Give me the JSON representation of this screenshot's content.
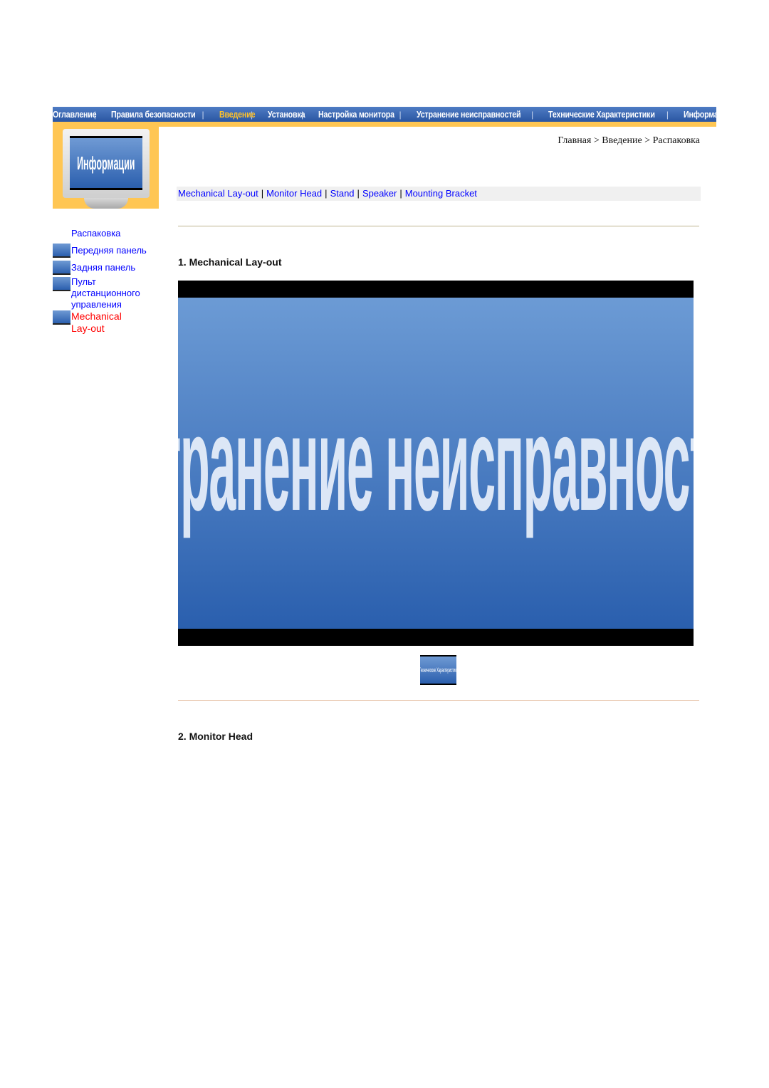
{
  "topnav": {
    "items": [
      {
        "label": "Оглавление",
        "active": false
      },
      {
        "label": "Правила безопасности",
        "active": false
      },
      {
        "label": "Введение",
        "active": true
      },
      {
        "label": "Установка",
        "active": false
      },
      {
        "label": "Настройка монитора",
        "active": false
      },
      {
        "label": "Устранение неисправностей",
        "active": false
      },
      {
        "label": "Технические Характеристики",
        "active": false
      },
      {
        "label": "Информаци",
        "active": false
      }
    ],
    "separator": "|",
    "colors": {
      "bar": "#2a56a2",
      "active": "#ffc22a",
      "accent_strip": "#ffc653"
    }
  },
  "header_image": {
    "screen_text": "Информации"
  },
  "breadcrumb": "Главная > Введение > Распаковка",
  "sidebar": {
    "items": [
      {
        "label": "Распаковка",
        "icon": false,
        "current": false
      },
      {
        "label": "Передняя панель",
        "icon": true,
        "current": false
      },
      {
        "label": "Задняя панель",
        "icon": true,
        "current": false
      },
      {
        "label": "Пульт дистанционного управления",
        "icon": true,
        "current": false
      },
      {
        "label": "Mechanical Lay-out",
        "icon": true,
        "current": true
      }
    ],
    "colors": {
      "link": "#0000ff",
      "current": "#ff0000"
    }
  },
  "subnav": {
    "links": [
      "Mechanical Lay-out",
      "Monitor Head",
      "Stand",
      "Speaker",
      "Mounting Bracket"
    ],
    "separator": "|"
  },
  "sections": [
    {
      "title": "1. Mechanical Lay-out",
      "image_text": "Устранение неисправностей"
    },
    {
      "title": "2. Monitor Head"
    }
  ],
  "button_image": {
    "text": "Технические Характеристики"
  }
}
